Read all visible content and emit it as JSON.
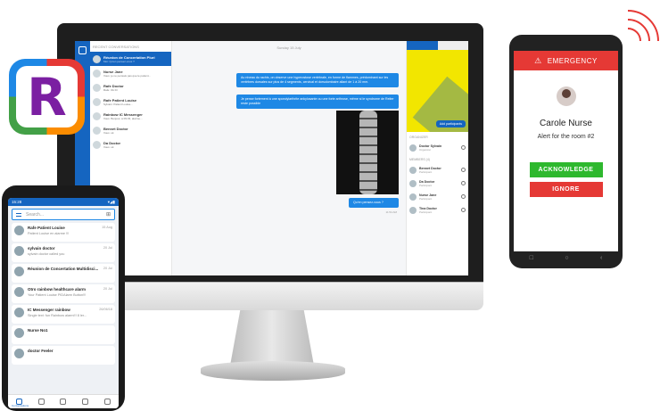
{
  "desktop": {
    "conversations_header": "Recent conversations",
    "conversations": [
      {
        "name": "Réunion de Concertation Pluri",
        "sub": "Moi: Qu'en pensez-vous ?",
        "active": true
      },
      {
        "name": "Nurse Jane",
        "sub": "Vous: je ne pensais pas que le patient..."
      },
      {
        "name": "Rafe Doctor",
        "sub": "Rafe: Ok Dr"
      },
      {
        "name": "Rafe Patient Louise",
        "sub": "Sylvain: Patient Louise..."
      },
      {
        "name": "Rainbow IC Messenger",
        "sub": "Vous: Bonjour, à 09:33, alarme..."
      },
      {
        "name": "Bennet Doctor",
        "sub": "Vous: ok"
      },
      {
        "name": "Da Doctor",
        "sub": "Vous: ok"
      }
    ],
    "chat": {
      "date": "Sunday 15 July",
      "messages": [
        "Au niveau du rachis, on observe une hyperostose vertébrale, en forme de flammes, prédominant sur les vertèbres dorsales sur plus de 4 segments, cervical et dorsolombaire allant de 1 à 20 mm.",
        "Je pense fortement à une spondylarthrite ankylosante ou une forte arthrose, même si le syndrome de Reiter reste possible",
        "Qu'en pensez-vous ?"
      ],
      "time": "11:54 AM"
    },
    "side": {
      "add_label": "Add participants",
      "organizer_header": "Organizer",
      "organizer": {
        "name": "Doctor Sylvain",
        "sub": "Organizer"
      },
      "members_header": "Members (4)",
      "members": [
        {
          "name": "Bennet Doctor",
          "sub": "Participant"
        },
        {
          "name": "Da Doctor",
          "sub": "Participant"
        },
        {
          "name": "Nurse Jane",
          "sub": "Participant"
        },
        {
          "name": "Tina Doctor",
          "sub": "Participant"
        }
      ]
    }
  },
  "logo": {
    "letter": "R"
  },
  "mobile_left": {
    "status_time": "15:28",
    "status_icons": "▾◢▮",
    "search_placeholder": "Search...",
    "items": [
      {
        "name": "Rafe Patient Louise",
        "sub": "Patient Louise en alarme !!!",
        "date": "15 Aug"
      },
      {
        "name": "sylvain doctor",
        "sub": "sylvain doctor called you",
        "date": "20 Jul"
      },
      {
        "name": "Réunion de Concertation Multidisci...",
        "sub": "",
        "date": "20 Jul"
      },
      {
        "name": "Otro rainbow healthcare alarm",
        "sub": "Your Patient Louise PIDAlarm Button!!!",
        "date": "20 Jul"
      },
      {
        "name": "IC Messenger rainbow",
        "sub": "Single text: fun Rainbow alarm!!! 8 ler...",
        "date": "26/06/18"
      },
      {
        "name": "Nurse No1",
        "sub": "",
        "date": ""
      },
      {
        "name": "doctor Feeler",
        "sub": "",
        "date": ""
      }
    ],
    "bottom_tab_label": "Conversations"
  },
  "mobile_right": {
    "header": "EMERGENCY",
    "name": "Carole Nurse",
    "alert": "Alert for the room #2",
    "acknowledge": "ACKNOWLEDGE",
    "ignore": "IGNORE",
    "nav": [
      "□",
      "○",
      "‹"
    ]
  }
}
